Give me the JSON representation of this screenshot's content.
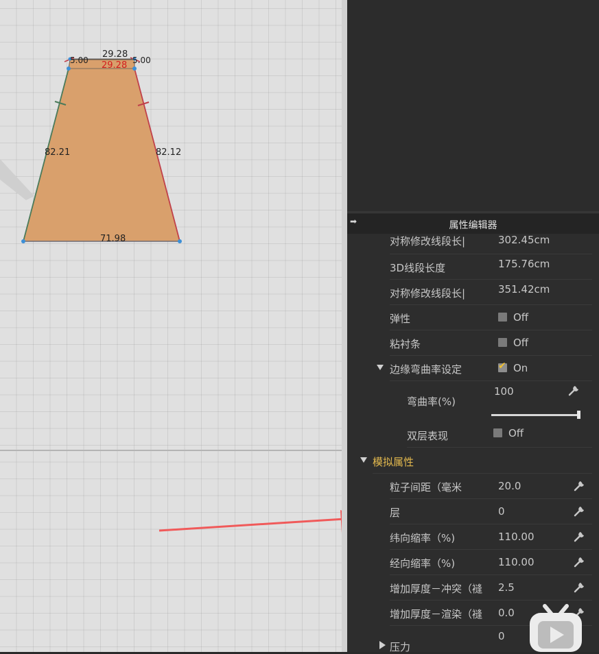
{
  "canvas": {
    "seam_lengths": {
      "top_a": "29.28",
      "top_b": "29.28",
      "top_left_corner": "5.00",
      "top_right_corner": "5.00",
      "left": "82.21",
      "right": "82.12",
      "bottom": "71.98"
    },
    "colors": {
      "pattern_fill": "#d9a06c",
      "left_seam": "#4a7a5a",
      "right_seam": "#c0404a",
      "annotation_arrow": "#f05a5a"
    }
  },
  "panel": {
    "title": "属性编辑器",
    "rows": [
      {
        "label": "对称修改线段长|",
        "value": "302.45cm"
      },
      {
        "label": "3D线段长度",
        "value": "175.76cm"
      },
      {
        "label": "对称修改线段长|",
        "value": "351.42cm"
      },
      {
        "label": "弹性",
        "value": "Off",
        "checked": false
      },
      {
        "label": "粘衬条",
        "value": "Off",
        "checked": false
      },
      {
        "label": "边缘弯曲率设定",
        "value": "On",
        "checked": true
      },
      {
        "label": "弯曲率(%)",
        "value": "100",
        "slider_fraction": 1.0
      },
      {
        "label": "双层表现",
        "value": "Off",
        "checked": false
      }
    ],
    "simulation": {
      "title": "模拟属性",
      "rows": [
        {
          "label": "粒子间距（毫米",
          "value": "20.0"
        },
        {
          "label": "层",
          "value": "0"
        },
        {
          "label": "纬向缩率（%)",
          "value": "110.00"
        },
        {
          "label": "经向缩率（%)",
          "value": "110.00"
        },
        {
          "label": "增加厚度－冲突（䙜",
          "value": "2.5"
        },
        {
          "label": "增加厚度－渲染（䙜",
          "value": "0.0"
        },
        {
          "label": "",
          "value": "0"
        }
      ]
    },
    "pressure": {
      "label": "压力"
    }
  },
  "icons": {
    "panel_collapse": "arrow-right-icon",
    "wrench": "wrench-icon",
    "watermark": "bilibili-tv-icon"
  }
}
